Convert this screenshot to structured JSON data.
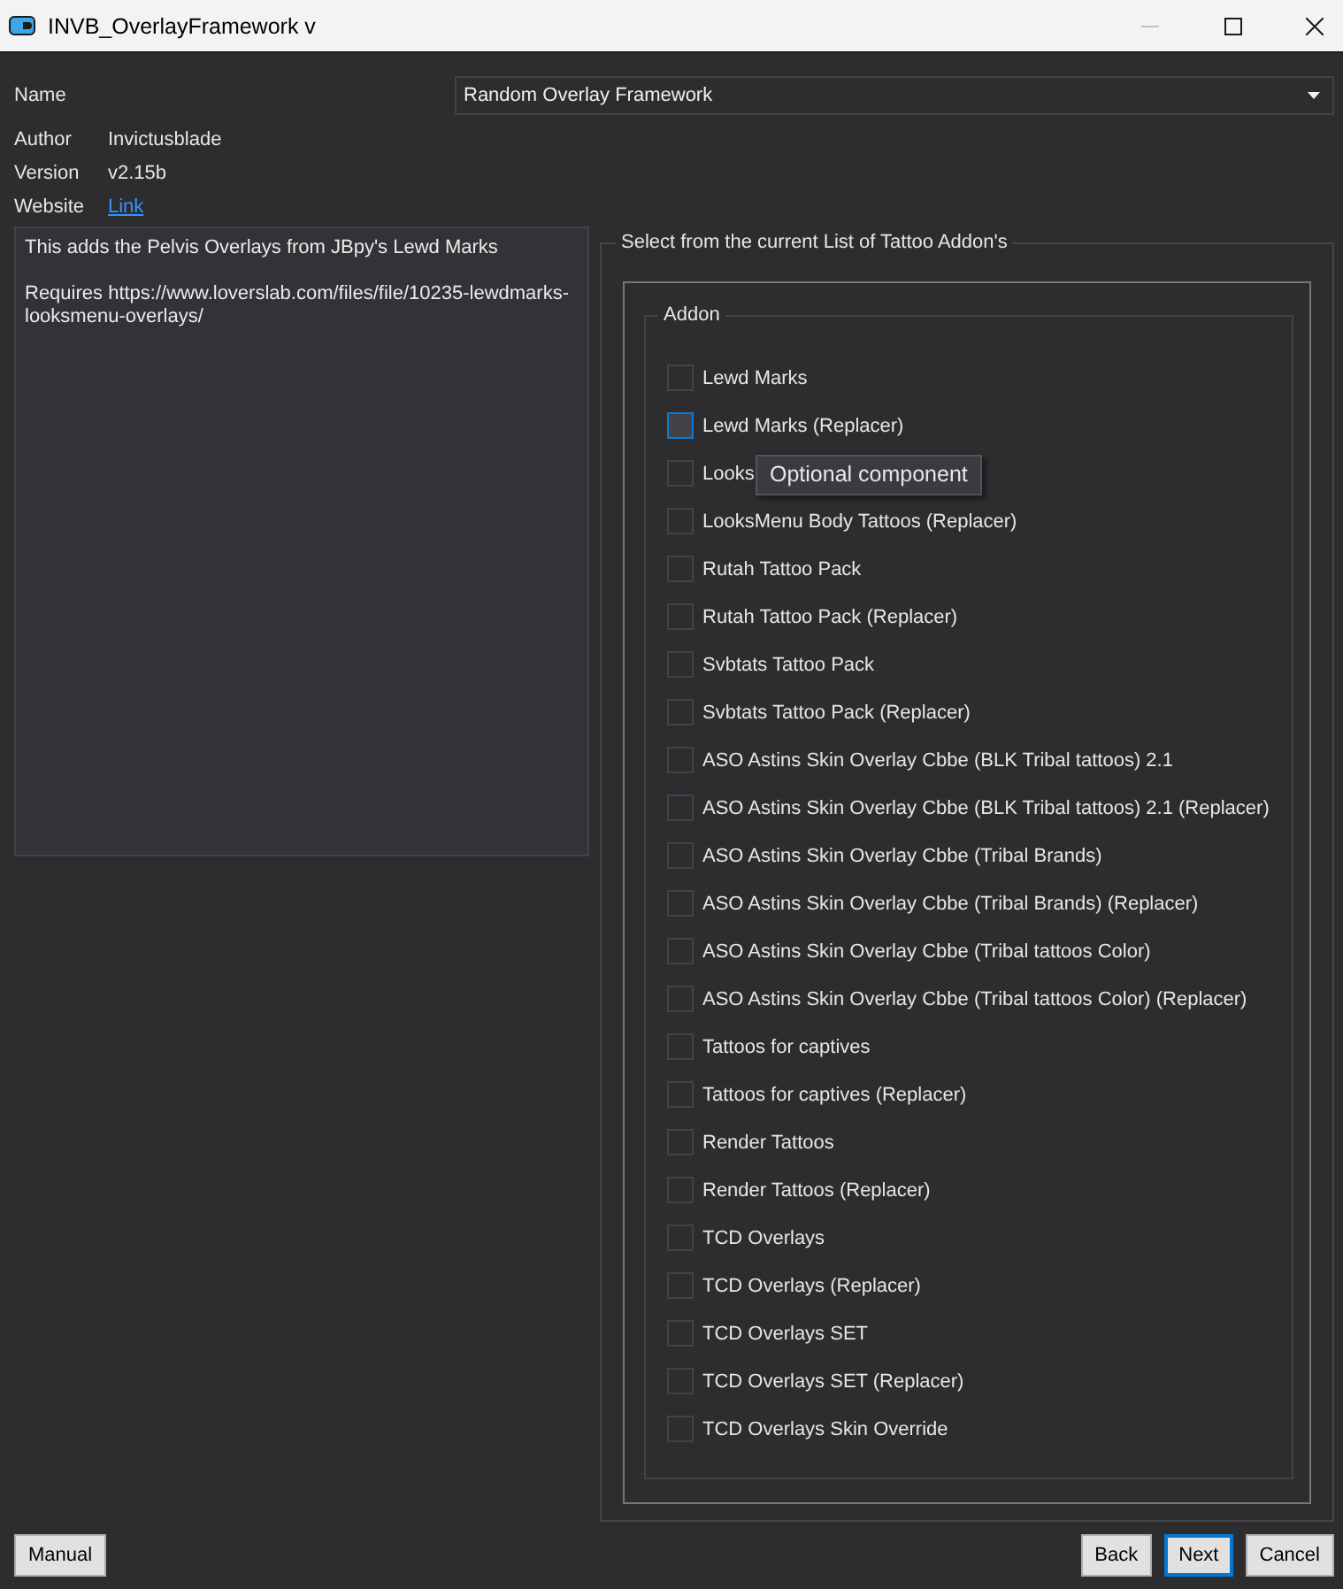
{
  "window": {
    "title": "INVB_OverlayFramework v",
    "controls": [
      {
        "kind": "minimize",
        "disabled": true
      },
      {
        "kind": "maximize",
        "disabled": false
      },
      {
        "kind": "close",
        "disabled": false
      }
    ]
  },
  "name_field": {
    "label": "Name",
    "value": "Random Overlay Framework"
  },
  "info": [
    {
      "label": "Author",
      "value": "Invictusblade",
      "kind": "text"
    },
    {
      "label": "Version",
      "value": "v2.15b",
      "kind": "text"
    },
    {
      "label": "Website",
      "value": "Link",
      "kind": "link"
    }
  ],
  "description": [
    "This adds the Pelvis Overlays from JBpy's Lewd Marks",
    "Requires https://www.loverslab.com/files/file/10235-lewdmarks-looksmenu-overlays/"
  ],
  "addon_section": {
    "title": "Select from the current List of Tattoo Addon's",
    "group_title": "Addon",
    "items": [
      {
        "label": "Lewd Marks",
        "checked": false,
        "hovered": false
      },
      {
        "label": "Lewd Marks (Replacer)",
        "checked": false,
        "hovered": true
      },
      {
        "label": "Looks",
        "checked": false,
        "hovered": false
      },
      {
        "label": "LooksMenu Body Tattoos (Replacer)",
        "checked": false,
        "hovered": false
      },
      {
        "label": "Rutah Tattoo Pack",
        "checked": false,
        "hovered": false
      },
      {
        "label": "Rutah Tattoo Pack (Replacer)",
        "checked": false,
        "hovered": false
      },
      {
        "label": "Svbtats Tattoo Pack",
        "checked": false,
        "hovered": false
      },
      {
        "label": "Svbtats Tattoo Pack (Replacer)",
        "checked": false,
        "hovered": false
      },
      {
        "label": "ASO Astins Skin Overlay Cbbe (BLK Tribal tattoos) 2.1",
        "checked": false,
        "hovered": false
      },
      {
        "label": "ASO Astins Skin Overlay Cbbe (BLK Tribal tattoos) 2.1 (Replacer)",
        "checked": false,
        "hovered": false
      },
      {
        "label": "ASO Astins Skin Overlay Cbbe (Tribal Brands)",
        "checked": false,
        "hovered": false
      },
      {
        "label": "ASO Astins Skin Overlay Cbbe (Tribal Brands) (Replacer)",
        "checked": false,
        "hovered": false
      },
      {
        "label": "ASO Astins Skin Overlay Cbbe (Tribal tattoos Color)",
        "checked": false,
        "hovered": false
      },
      {
        "label": "ASO Astins Skin Overlay Cbbe (Tribal tattoos Color) (Replacer)",
        "checked": false,
        "hovered": false
      },
      {
        "label": "Tattoos for captives",
        "checked": false,
        "hovered": false
      },
      {
        "label": "Tattoos for captives (Replacer)",
        "checked": false,
        "hovered": false
      },
      {
        "label": "Render Tattoos",
        "checked": false,
        "hovered": false
      },
      {
        "label": "Render Tattoos (Replacer)",
        "checked": false,
        "hovered": false
      },
      {
        "label": "TCD Overlays",
        "checked": false,
        "hovered": false
      },
      {
        "label": "TCD Overlays (Replacer)",
        "checked": false,
        "hovered": false
      },
      {
        "label": "TCD Overlays SET",
        "checked": false,
        "hovered": false
      },
      {
        "label": "TCD Overlays SET (Replacer)",
        "checked": false,
        "hovered": false
      },
      {
        "label": "TCD Overlays Skin Override",
        "checked": false,
        "hovered": false
      }
    ]
  },
  "tooltip": {
    "text": "Optional component"
  },
  "footer": {
    "left": [
      {
        "label": "Manual",
        "focused": false
      }
    ],
    "right": [
      {
        "label": "Back",
        "focused": false
      },
      {
        "label": "Next",
        "focused": true
      },
      {
        "label": "Cancel",
        "focused": false
      }
    ]
  }
}
